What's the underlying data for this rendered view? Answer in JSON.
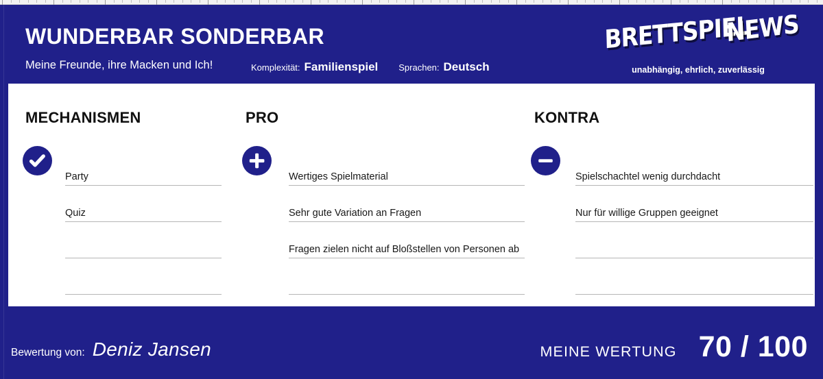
{
  "theme": {
    "brand_blue": "#20208a",
    "panel_white": "#ffffff",
    "rule_gray": "#b5b5b5",
    "text_dark": "#181818"
  },
  "header": {
    "title": "WUNDERBAR SONDERBAR",
    "subtitle": "Meine Freunde, ihre Macken und Ich!",
    "meta": {
      "complexity_label": "Komplexität:",
      "complexity_value": "Familienspiel",
      "languages_label": "Sprachen:",
      "languages_value": "Deutsch"
    }
  },
  "logo": {
    "word_1": "BRETTSPIEL",
    "word_2": "NEWS",
    "tagline": "unabhängig, ehrlich, zuverlässig"
  },
  "columns": [
    {
      "id": "mechanismen",
      "title": "MECHANISMEN",
      "icon": "check-circle-icon",
      "entries": [
        "Party",
        "Quiz",
        "",
        ""
      ]
    },
    {
      "id": "pro",
      "title": "PRO",
      "icon": "plus-circle-icon",
      "entries": [
        "Wertiges Spielmaterial",
        "Sehr gute Variation an Fragen",
        "Fragen zielen nicht auf Bloßstellen von Personen ab",
        ""
      ]
    },
    {
      "id": "kontra",
      "title": "KONTRA",
      "icon": "minus-circle-icon",
      "entries": [
        "Spielschachtel wenig durchdacht",
        "Nur für willige Gruppen geeignet",
        "",
        ""
      ]
    }
  ],
  "footer": {
    "reviewer_label": "Bewertung von:",
    "reviewer_name": "Deniz Jansen",
    "score_label": "MEINE WERTUNG",
    "score_value": "70 / 100"
  }
}
